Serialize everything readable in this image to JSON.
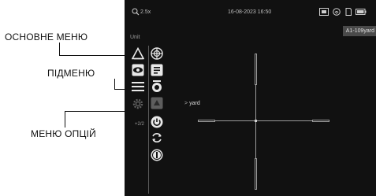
{
  "callouts": {
    "main_menu": "ОСНОВНЕ МЕНЮ",
    "submenu": "ПІДМЕНЮ",
    "options_menu": "МЕНЮ ОПЦІЙ"
  },
  "status_bar": {
    "zoom": "2.5x",
    "datetime": "16-08-2023 16:50",
    "icons": [
      "zoom-icon",
      "photo-mode-icon",
      "wifi-icon",
      "sd-card-icon",
      "battery-icon"
    ]
  },
  "range_tag": "A1-109yard",
  "menu": {
    "title": "Unit",
    "main_icons": [
      "reticle-icon",
      "eye-icon",
      "list-icon",
      "settings-icon"
    ],
    "scale_label": "+2/2",
    "sub_icons": [
      "crosshair-icon",
      "document-icon",
      "zero-icon",
      "unit-icon",
      "power-icon",
      "restore-icon",
      "info-icon"
    ],
    "selected_unit": "yard"
  },
  "colors": {
    "screen_bg": "#111111",
    "icon_fg": "#e8e8e8",
    "reticle": "#9a9a9a",
    "callout_text": "#111111"
  }
}
